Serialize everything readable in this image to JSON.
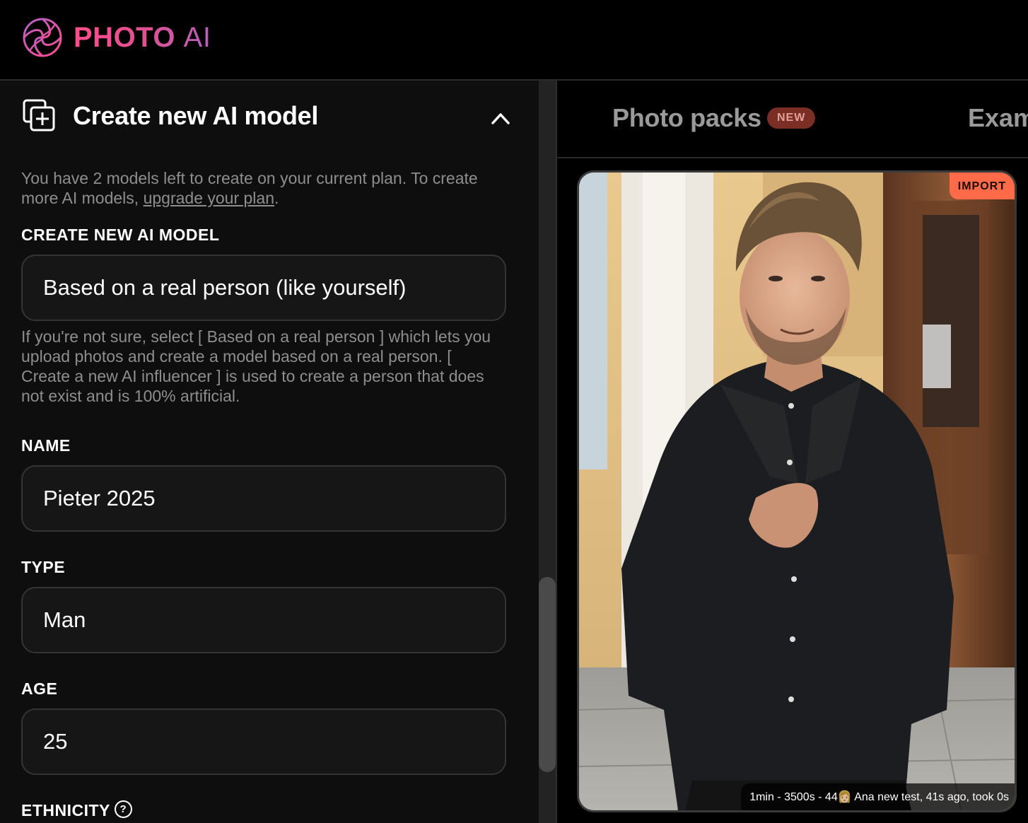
{
  "app": {
    "logo_word": "PHOTO",
    "logo_ai": "AI",
    "logo_tm": "™"
  },
  "left_panel": {
    "title": "Create new AI model",
    "notice_prefix": "You have 2 models left to create on your current plan. To create more AI models, ",
    "notice_link": "upgrade your plan",
    "notice_suffix": ".",
    "create_label": "CREATE NEW AI MODEL",
    "create_value": "Based on a real person (like yourself)",
    "create_hint": "If you're not sure, select [ Based on a real person ] which lets you upload photos and create a model based on a real person. [ Create a new AI influencer ] is used to create a person that does not exist and is 100% artificial.",
    "name_label": "NAME",
    "name_value": "Pieter 2025",
    "type_label": "TYPE",
    "type_value": "Man",
    "age_label": "AGE",
    "age_value": "25",
    "ethnicity_label": "ETHNICITY",
    "ethnicity_help": "?"
  },
  "right_panel": {
    "tab_photo_packs": "Photo packs",
    "tab_badge": "NEW",
    "tab_examples": "Exam",
    "import_badge": "IMPORT",
    "caption": "1min - 3500s - 44👩🏼 Ana new test, 41s ago, took 0s"
  },
  "colors": {
    "accent_pink": "#ff4d8d",
    "accent_purple": "#b061c4",
    "import_orange": "#ff6b48",
    "new_badge": "#7a2e24"
  }
}
